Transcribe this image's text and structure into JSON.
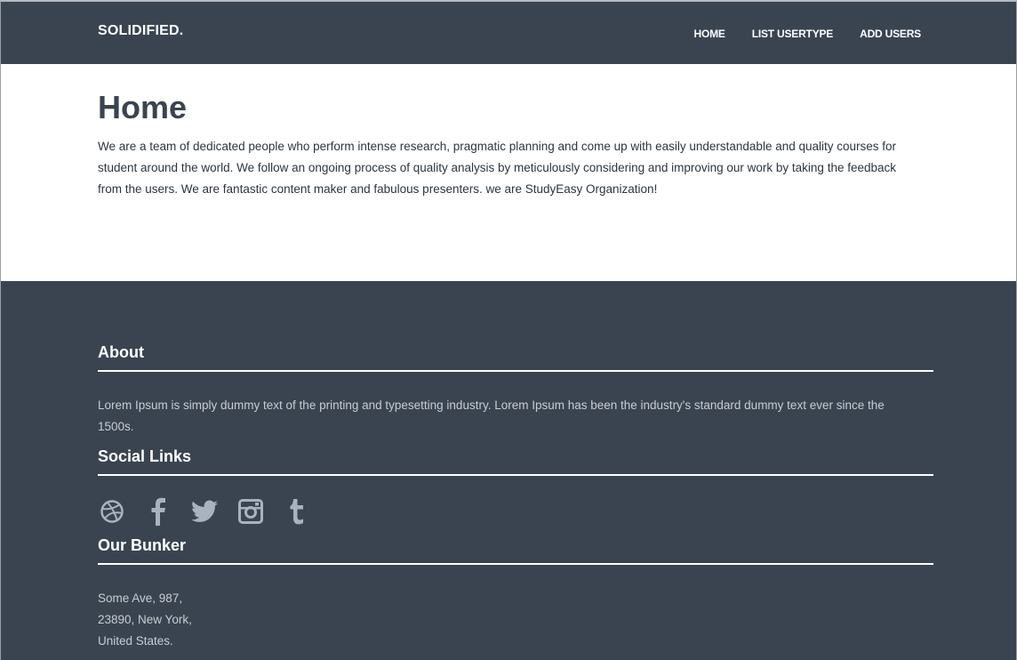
{
  "navbar": {
    "brand": "SOLIDIFIED.",
    "links": [
      "HOME",
      "LIST USERTYPE",
      "ADD USERS"
    ]
  },
  "main": {
    "title": "Home",
    "intro": "We are a team of dedicated people who perform intense research, pragmatic planning and come up with easily understandable and quality courses for student around the world. We follow an ongoing process of quality analysis by meticulously considering and improving our work by taking the feedback from the users. We are fantastic content maker and fabulous presenters. we are StudyEasy Organization!"
  },
  "footer": {
    "about": {
      "title": "About",
      "text": "Lorem Ipsum is simply dummy text of the printing and typesetting industry. Lorem Ipsum has been the industry's standard dummy text ever since the 1500s."
    },
    "social": {
      "title": "Social Links",
      "icons": [
        "dribbble-icon",
        "facebook-icon",
        "twitter-icon",
        "instagram-icon",
        "tumblr-icon"
      ]
    },
    "bunker": {
      "title": "Our Bunker",
      "address": [
        "Some Ave, 987,",
        "23890, New York,",
        "United States."
      ]
    }
  },
  "colors": {
    "nav_bg": "#3a4451",
    "footer_bg": "#3a4451",
    "title": "#3a4451",
    "footer_text": "#c7ccd2",
    "icon": "#a9b3be"
  }
}
